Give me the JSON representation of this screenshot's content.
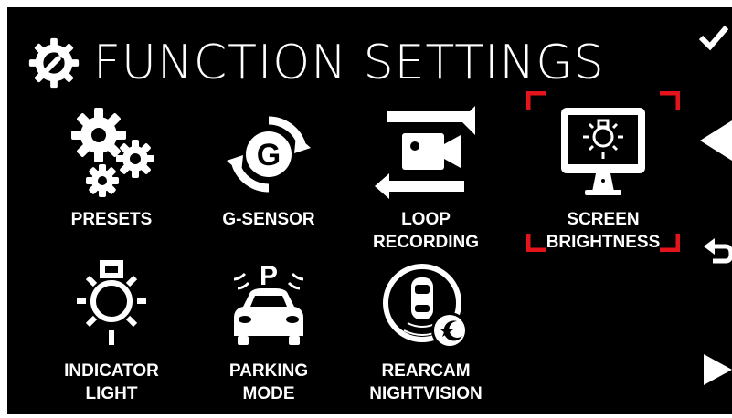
{
  "header": {
    "title": "FUNCTION SETTINGS",
    "icon": "wrench-gear-icon"
  },
  "menu": {
    "items": [
      {
        "label": "PRESETS",
        "icon": "gears-icon",
        "selected": false
      },
      {
        "label": "G-SENSOR",
        "icon": "g-sensor-icon",
        "selected": false
      },
      {
        "label_line1": "LOOP",
        "label_line2": "RECORDING",
        "icon": "loop-recording-icon",
        "selected": false
      },
      {
        "label_line1": "SCREEN",
        "label_line2": "BRIGHTNESS",
        "icon": "screen-brightness-icon",
        "selected": true
      },
      {
        "label_line1": "INDICATOR",
        "label_line2": "LIGHT",
        "icon": "indicator-light-icon",
        "selected": false
      },
      {
        "label_line1": "PARKING",
        "label_line2": "MODE",
        "icon": "parking-mode-icon",
        "selected": false
      },
      {
        "label_line1": "REARCAM",
        "label_line2": "NIGHTVISION",
        "icon": "rearcam-nightvision-icon",
        "selected": false
      }
    ]
  },
  "sidebar": {
    "buttons": [
      "confirm-check-icon",
      "previous-arrow-icon",
      "back-return-icon",
      "next-arrow-icon"
    ]
  },
  "colors": {
    "background": "#000000",
    "foreground": "#ffffff",
    "selection": "#e3141b"
  }
}
